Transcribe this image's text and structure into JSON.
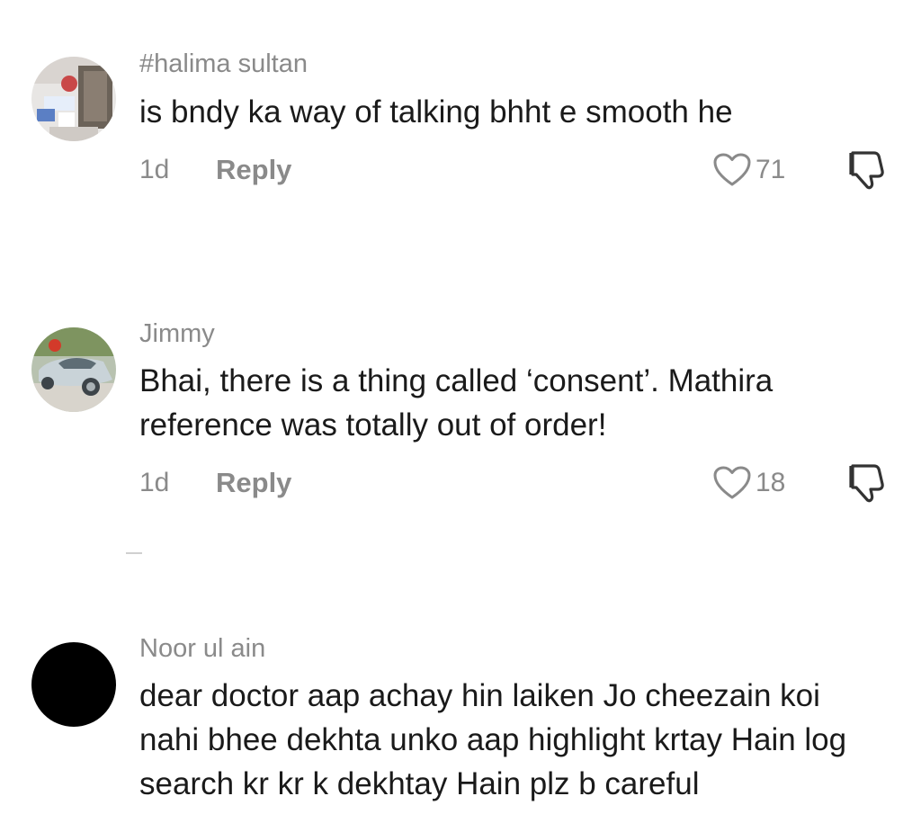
{
  "comments": [
    {
      "author": "#halima sultan",
      "text": "is bndy ka way of talking bhht e smooth he",
      "time": "1d",
      "reply_label": "Reply",
      "likes": "71",
      "avatar_icon": "avatar-photo-icon"
    },
    {
      "author": "Jimmy",
      "text": "Bhai, there is a thing called ‘consent’. Mathira reference was totally out of order!",
      "time": "1d",
      "reply_label": "Reply",
      "likes": "18",
      "avatar_icon": "avatar-car-photo-icon"
    },
    {
      "author": "Noor ul ain",
      "text": "dear doctor aap achay hin laiken Jo cheezain koi nahi bhee dekhta unko aap highlight krtay Hain log search kr kr k dekhtay Hain plz b careful",
      "avatar_icon": "avatar-black-icon"
    }
  ],
  "icons": {
    "like": "heart-outline-icon",
    "dislike": "thumbs-down-outline-icon"
  },
  "colors": {
    "secondary_text": "#8a8a8a",
    "primary_text": "#1a1a1a",
    "background": "#ffffff"
  }
}
